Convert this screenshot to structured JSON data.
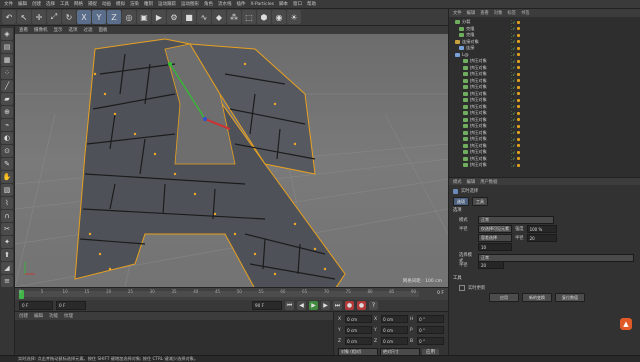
{
  "menu": [
    "文件",
    "编辑",
    "创建",
    "选择",
    "工具",
    "网格",
    "捕捉",
    "动画",
    "模拟",
    "渲染",
    "雕刻",
    "运动跟踪",
    "运动图形",
    "角色",
    "流水线",
    "插件",
    "X-Particles",
    "脚本",
    "窗口",
    "帮助"
  ],
  "toolbar": {
    "icons": [
      "undo-icon",
      "pointer-icon",
      "move-icon",
      "scale-icon",
      "rotate-icon",
      "x-axis-icon",
      "y-axis-icon",
      "z-axis-icon",
      "world-icon",
      "render-region-icon",
      "render-view-icon",
      "render-settings-icon",
      "cube-icon",
      "spline-icon",
      "nurbs-icon",
      "array-icon",
      "deformer-icon",
      "scene-icon",
      "camera-icon",
      "light-icon"
    ],
    "axis_labels": [
      "X",
      "Y",
      "Z"
    ]
  },
  "viewport": {
    "menu": [
      "查看",
      "摄像机",
      "显示",
      "选项",
      "过滤",
      "面板"
    ],
    "grid_info": "网格间距 : 100 cm"
  },
  "timeline": {
    "ticks": [
      "0",
      "5",
      "10",
      "15",
      "20",
      "25",
      "30",
      "35",
      "40",
      "45",
      "50",
      "55",
      "60",
      "65",
      "70",
      "75",
      "80",
      "85",
      "90"
    ],
    "end_label": "0 F",
    "current_frame": "0 F",
    "start_field": "0 F",
    "end_field": "90 F",
    "end_field2": "90 F"
  },
  "materials": {
    "menu": [
      "创建",
      "编辑",
      "功能",
      "纹理"
    ]
  },
  "coords": {
    "rows": [
      {
        "axis": "X",
        "pos": "0 cm",
        "size": "0 cm",
        "rot_label": "H",
        "rot": "0 °"
      },
      {
        "axis": "Y",
        "pos": "0 cm",
        "size": "0 cm",
        "rot_label": "P",
        "rot": "0 °"
      },
      {
        "axis": "Z",
        "pos": "0 cm",
        "size": "0 cm",
        "rot_label": "B",
        "rot": "0 °"
      }
    ],
    "mode1": "对象 (相对)",
    "mode2": "绝对尺寸",
    "apply": "应用"
  },
  "object_manager": {
    "menu": [
      "文件",
      "编辑",
      "查看",
      "对象",
      "标签",
      "书签"
    ],
    "objects": [
      {
        "name": "分裂",
        "color": "#6fae5f",
        "indent": 2
      },
      {
        "name": "克隆",
        "color": "#6fae5f",
        "indent": 6
      },
      {
        "name": "克隆",
        "color": "#6fae5f",
        "indent": 6
      },
      {
        "name": "连接对象",
        "color": "#c9a040",
        "indent": 2
      },
      {
        "name": "连接",
        "color": "#7aa0d8",
        "indent": 6
      },
      {
        "name": "L@",
        "color": "#7aa0d8",
        "indent": 2
      },
      {
        "name": "挤压对象",
        "color": "#6fae5f",
        "indent": 10
      },
      {
        "name": "挤压对象",
        "color": "#6fae5f",
        "indent": 10
      },
      {
        "name": "挤压对象",
        "color": "#6fae5f",
        "indent": 10
      },
      {
        "name": "挤压对象",
        "color": "#6fae5f",
        "indent": 10
      },
      {
        "name": "挤压对象",
        "color": "#6fae5f",
        "indent": 10
      },
      {
        "name": "挤压对象",
        "color": "#6fae5f",
        "indent": 10
      },
      {
        "name": "挤压对象",
        "color": "#6fae5f",
        "indent": 10
      },
      {
        "name": "挤压对象",
        "color": "#6fae5f",
        "indent": 10
      },
      {
        "name": "挤压对象",
        "color": "#6fae5f",
        "indent": 10
      },
      {
        "name": "挤压对象",
        "color": "#6fae5f",
        "indent": 10
      },
      {
        "name": "挤压对象",
        "color": "#6fae5f",
        "indent": 10
      },
      {
        "name": "挤压对象",
        "color": "#6fae5f",
        "indent": 10
      },
      {
        "name": "挤压对象",
        "color": "#6fae5f",
        "indent": 10
      },
      {
        "name": "挤压对象",
        "color": "#6fae5f",
        "indent": 10
      },
      {
        "name": "挤压对象",
        "color": "#6fae5f",
        "indent": 10
      },
      {
        "name": "挤压对象",
        "color": "#6fae5f",
        "indent": 10
      },
      {
        "name": "挤压对象",
        "color": "#6fae5f",
        "indent": 10
      }
    ]
  },
  "attributes": {
    "menu": [
      "模式",
      "编辑",
      "用户数据"
    ],
    "title": "实时选择",
    "tabs": [
      "选项",
      "工具"
    ],
    "section": "选项",
    "rows": [
      {
        "label": "半径",
        "value": "10",
        "dd": ""
      },
      {
        "label": "",
        "value": "",
        "dd": "仅选择可见元素"
      },
      {
        "label": "",
        "value": "",
        "dd": "容差选择"
      }
    ],
    "mode_label": "模式",
    "mode_value": "正常",
    "radius_label": "半径",
    "radius_value": "20",
    "strength_label": "强度",
    "strength_value": "100 %",
    "sel_label": "选择模式",
    "sel_value": "正常",
    "buttons": [
      "实时更新",
      "应用",
      "新的变换",
      "复位数值"
    ]
  },
  "status": "实时选择: 点击并拖动鼠标选择元素。按住 SHIFT 键增加选择对象; 按住 CTRL 键减少选择对象。"
}
